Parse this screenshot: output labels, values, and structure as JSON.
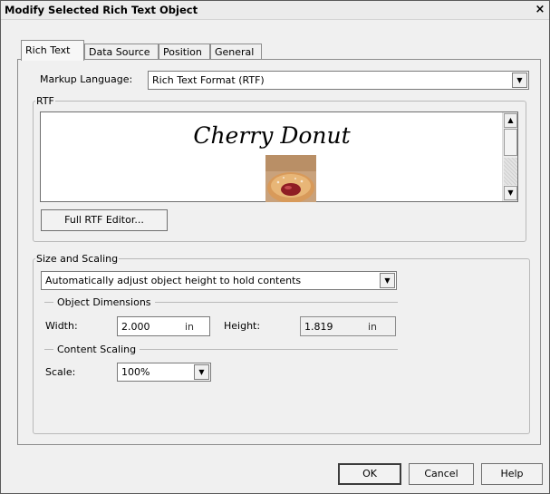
{
  "window": {
    "title": "Modify Selected Rich Text Object",
    "close_glyph": "×"
  },
  "tabs": [
    {
      "label": "Rich Text",
      "active": true
    },
    {
      "label": "Data Source",
      "active": false
    },
    {
      "label": "Position",
      "active": false
    },
    {
      "label": "General",
      "active": false
    }
  ],
  "markup": {
    "label": "Markup Language:",
    "value": "Rich Text Format (RTF)"
  },
  "rtf": {
    "group_label": "RTF",
    "content_text": "Cherry Donut",
    "image": "donut-photo",
    "editor_button": "Full RTF Editor..."
  },
  "size_scaling": {
    "group_label": "Size and Scaling",
    "mode_value": "Automatically adjust object height to hold contents",
    "dimensions_heading": "Object Dimensions",
    "width_label": "Width:",
    "width_value": "2.000",
    "width_unit": "in",
    "height_label": "Height:",
    "height_value": "1.819",
    "height_unit": "in",
    "content_scaling_heading": "Content Scaling",
    "scale_label": "Scale:",
    "scale_value": "100%"
  },
  "footer": {
    "ok": "OK",
    "cancel": "Cancel",
    "help": "Help"
  },
  "icons": {
    "dropdown": "chevron-down-icon",
    "scroll_up": "arrow-up-icon",
    "scroll_down": "arrow-down-icon",
    "close": "close-icon"
  }
}
